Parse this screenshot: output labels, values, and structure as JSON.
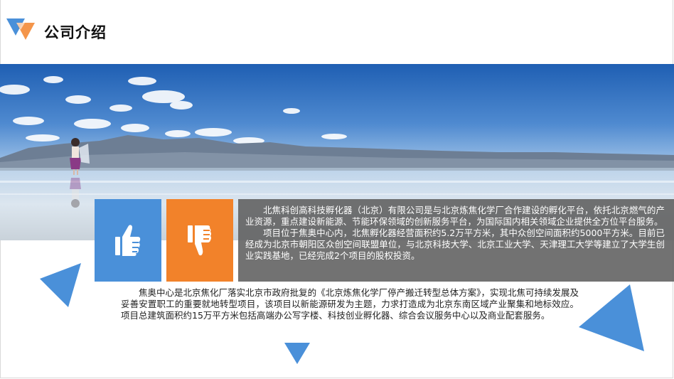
{
  "header": {
    "title": "公司介绍"
  },
  "colors": {
    "blue": "#4a90d9",
    "orange": "#f2822a",
    "panel_gray": "#5f5f5f"
  },
  "icons": {
    "left": "thumbs-up-icon",
    "right": "thumbs-down-icon"
  },
  "panel": {
    "paragraphs": [
      "北焦科创高科技孵化器（北京）有限公司是与北京炼焦化学厂合作建设的孵化平台，依托北京燃气的产业资源，重点建设新能源、节能环保领域的创新服务平台，为国际国内相关领域企业提供全方位平台服务。",
      "项目位于焦奥中心内，北焦孵化器经营面积约5.2万平方米，其中众创空间面积约5000平方米。目前已经成为北京市朝阳区众创空间联盟单位，与北京科技大学、北京工业大学、天津理工大学等建立了大学生创业实践基地，已经完成2个项目的股权投资。"
    ]
  },
  "body": {
    "paragraph": "焦奥中心是北京焦化厂落实北京市政府批复的《北京炼焦化学厂停产搬迁转型总体方案》，实现北焦可持续发展及妥善安置职工的重要就地转型项目，该项目以新能源研发为主题，力求打造成为北京东南区域产业聚集和地标效应。项目总建筑面积约15万平方米包括高端办公写字楼、科技创业孵化器、综合会议服务中心以及商业配套服务。"
  }
}
